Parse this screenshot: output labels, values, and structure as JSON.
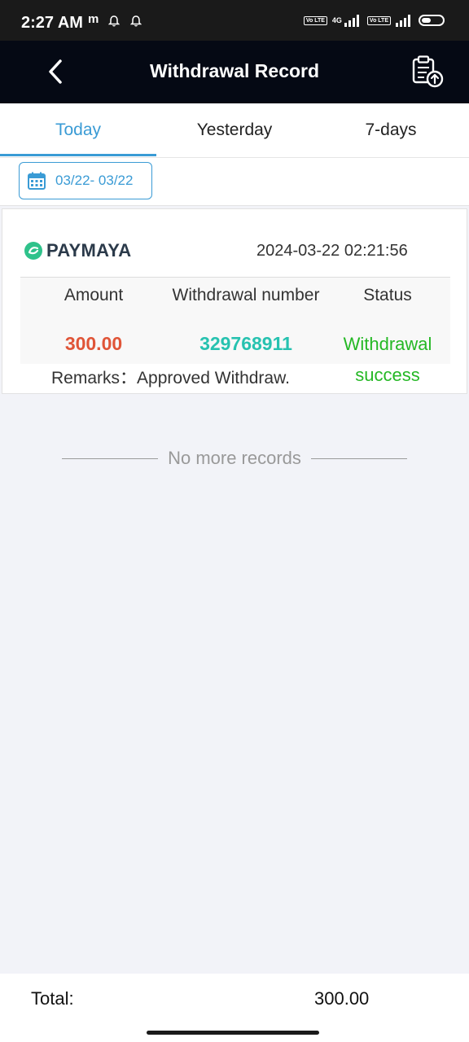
{
  "status_bar": {
    "time": "2:27 AM",
    "carrier_glyph": "m",
    "network": "4G",
    "volte_label": "Vo LTE",
    "battery_level": 0.45
  },
  "header": {
    "title": "Withdrawal Record",
    "back_icon": "chevron-left-icon",
    "action_icon": "clipboard-upload-icon"
  },
  "tabs": [
    {
      "label": "Today",
      "active": true
    },
    {
      "label": "Yesterday",
      "active": false
    },
    {
      "label": "7-days",
      "active": false
    }
  ],
  "date_filter": {
    "icon": "calendar-icon",
    "range": "03/22- 03/22"
  },
  "records": [
    {
      "provider": "PAYMAYA",
      "datetime": "2024-03-22 02:21:56",
      "columns": [
        "Amount",
        "Withdrawal number",
        "Status"
      ],
      "amount": "300.00",
      "withdrawal_number": "329768911",
      "status_line1": "Withdrawal",
      "status_line2": "success",
      "remarks_label": "Remarks：",
      "remarks_value": "Approved Withdraw."
    }
  ],
  "list_end_text": "No more records",
  "footer": {
    "total_label": "Total:",
    "total_value": "300.00"
  },
  "colors": {
    "accent": "#3a9bd5",
    "amount": "#e05538",
    "withdrawal_number": "#27c2b0",
    "success": "#25b825",
    "navbar": "#050914"
  }
}
